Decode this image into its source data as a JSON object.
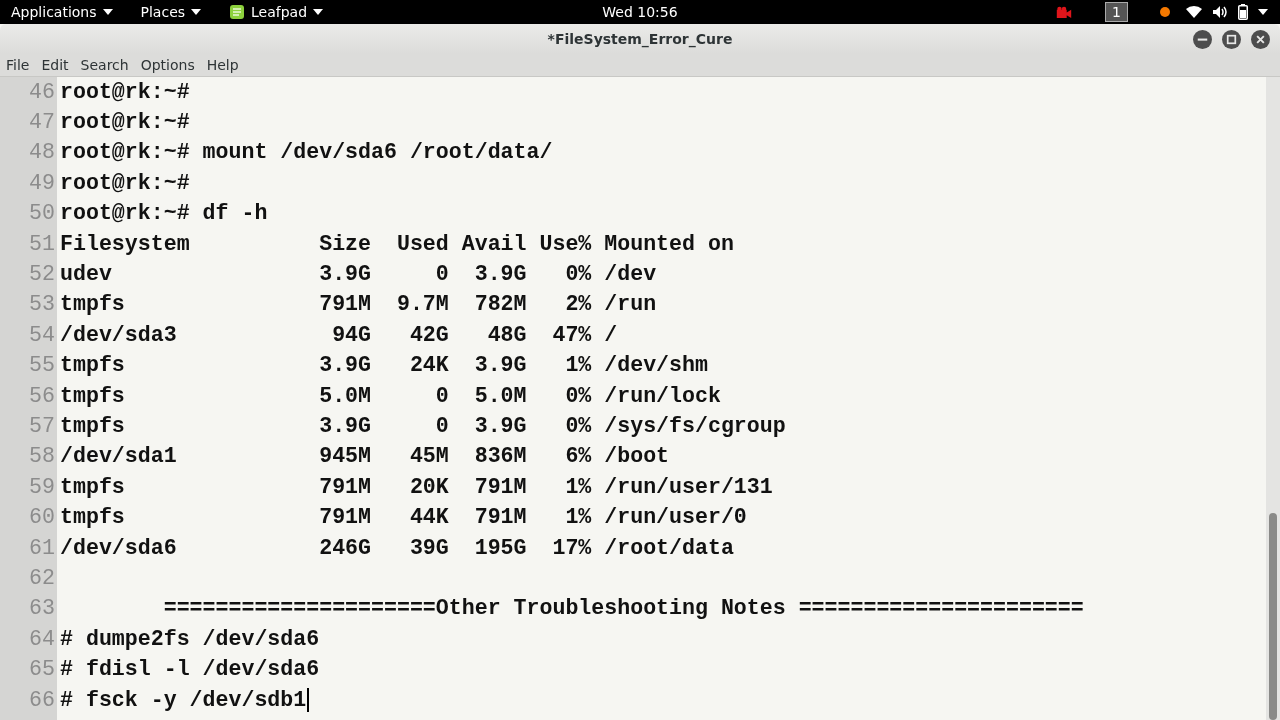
{
  "top_bar": {
    "menus": [
      {
        "label": "Applications",
        "kind": "menu"
      },
      {
        "label": "Places",
        "kind": "menu"
      },
      {
        "label": "Leafpad",
        "kind": "app"
      }
    ],
    "clock": "Wed 10:56",
    "workspace": "1"
  },
  "window": {
    "title": "*FileSystem_Error_Cure"
  },
  "menu_bar": [
    "File",
    "Edit",
    "Search",
    "Options",
    "Help"
  ],
  "editor": {
    "lines": [
      {
        "number": "46",
        "text": "root@rk:~#",
        "cursor": false
      },
      {
        "number": "47",
        "text": "root@rk:~#",
        "cursor": false
      },
      {
        "number": "48",
        "text": "root@rk:~# mount /dev/sda6 /root/data/",
        "cursor": false
      },
      {
        "number": "49",
        "text": "root@rk:~#",
        "cursor": false
      },
      {
        "number": "50",
        "text": "root@rk:~# df -h",
        "cursor": false
      },
      {
        "number": "51",
        "text": "Filesystem          Size  Used Avail Use% Mounted on",
        "cursor": false
      },
      {
        "number": "52",
        "text": "udev                3.9G     0  3.9G   0% /dev",
        "cursor": false
      },
      {
        "number": "53",
        "text": "tmpfs               791M  9.7M  782M   2% /run",
        "cursor": false
      },
      {
        "number": "54",
        "text": "/dev/sda3            94G   42G   48G  47% /",
        "cursor": false
      },
      {
        "number": "55",
        "text": "tmpfs               3.9G   24K  3.9G   1% /dev/shm",
        "cursor": false
      },
      {
        "number": "56",
        "text": "tmpfs               5.0M     0  5.0M   0% /run/lock",
        "cursor": false
      },
      {
        "number": "57",
        "text": "tmpfs               3.9G     0  3.9G   0% /sys/fs/cgroup",
        "cursor": false
      },
      {
        "number": "58",
        "text": "/dev/sda1           945M   45M  836M   6% /boot",
        "cursor": false
      },
      {
        "number": "59",
        "text": "tmpfs               791M   20K  791M   1% /run/user/131",
        "cursor": false
      },
      {
        "number": "60",
        "text": "tmpfs               791M   44K  791M   1% /run/user/0",
        "cursor": false
      },
      {
        "number": "61",
        "text": "/dev/sda6           246G   39G  195G  17% /root/data",
        "cursor": false
      },
      {
        "number": "62",
        "cursor": false
      },
      {
        "number": "63",
        "text": "        =====================Other Troubleshooting Notes ======================",
        "cursor": false
      },
      {
        "number": "64",
        "text": "# dumpe2fs /dev/sda6",
        "cursor": false
      },
      {
        "number": "65",
        "text": "# fdisl -l /dev/sda6",
        "cursor": false
      },
      {
        "number": "66",
        "text": "# fsck -y /dev/sdb1",
        "cursor": true
      }
    ]
  }
}
